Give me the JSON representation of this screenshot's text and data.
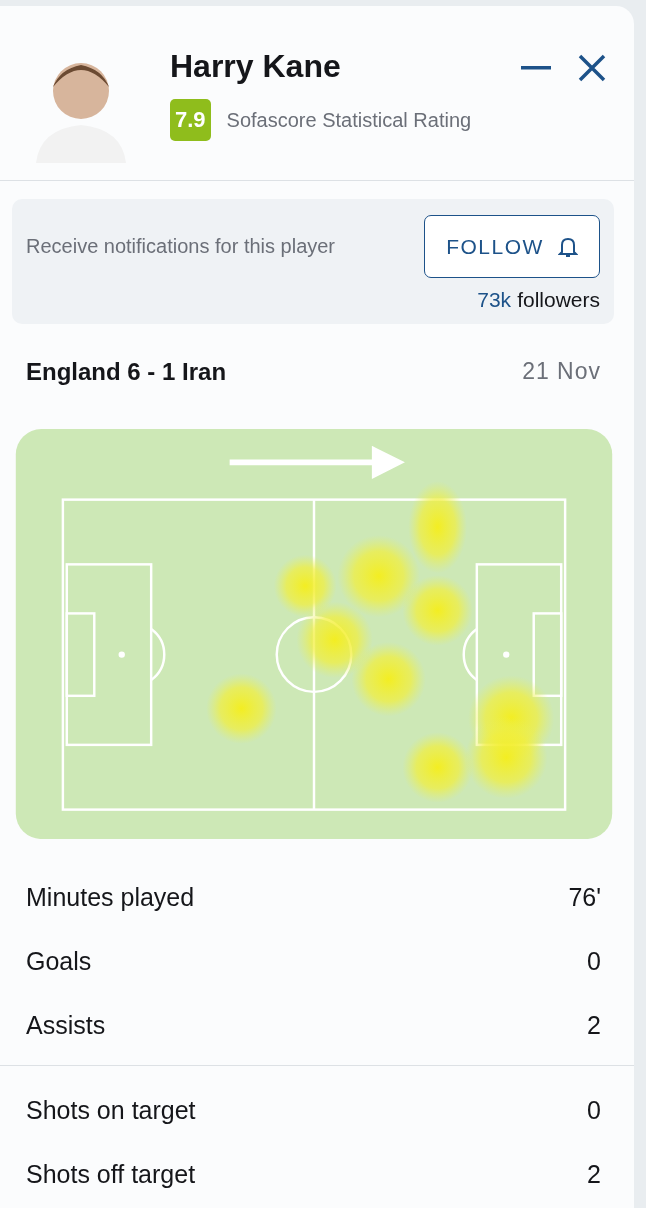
{
  "player": {
    "name": "Harry Kane",
    "rating": "7.9",
    "rating_label": "Sofascore Statistical Rating"
  },
  "window_controls": [
    {
      "kind": "minimize"
    },
    {
      "kind": "close"
    }
  ],
  "follow": {
    "text": "Receive notifications for this player",
    "button": "FOLLOW",
    "count": "73k",
    "count_label": "followers"
  },
  "match": {
    "title": "England 6 - 1 Iran",
    "date": "21 Nov"
  },
  "heatmap": {
    "kind": "picture"
  },
  "stat_groups": [
    [
      {
        "label": "Minutes played",
        "value": "76'"
      },
      {
        "label": "Goals",
        "value": "0"
      },
      {
        "label": "Assists",
        "value": "2"
      }
    ],
    [
      {
        "label": "Shots on target",
        "value": "0"
      },
      {
        "label": "Shots off target",
        "value": "2"
      }
    ]
  ]
}
